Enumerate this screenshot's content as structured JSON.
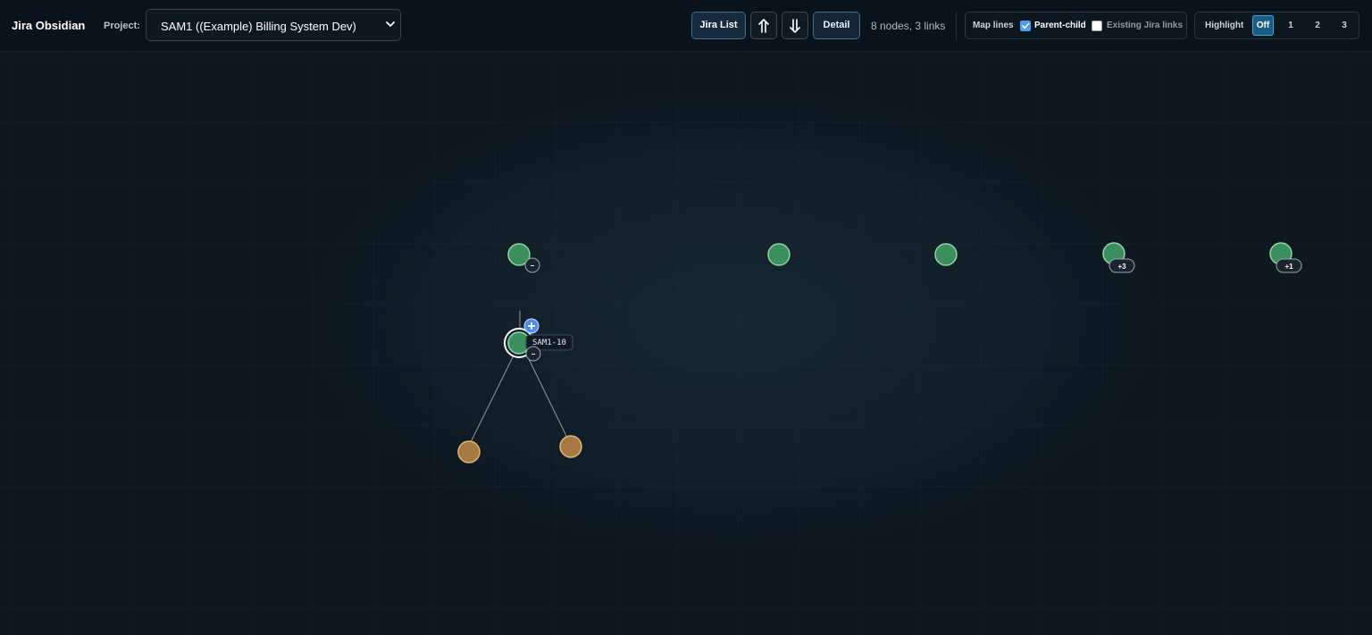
{
  "app": {
    "title": "Jira Obsidian"
  },
  "project": {
    "label": "Project:",
    "selected": "SAM1 ((Example) Billing System Dev)"
  },
  "toolbar": {
    "jira_list": "Jira List",
    "expand_up_icon": "double-arrow-up-icon",
    "expand_down_icon": "double-arrow-down-icon",
    "detail": "Detail",
    "status": "8 nodes, 3 links"
  },
  "map_lines": {
    "label": "Map lines",
    "parent_child": {
      "label": "Parent-child",
      "checked": true
    },
    "existing_jira_links": {
      "label": "Existing Jira links",
      "checked": false
    }
  },
  "highlight": {
    "label": "Highlight",
    "options": [
      "Off",
      "1",
      "2",
      "3"
    ],
    "selected": "Off"
  },
  "graph": {
    "colors": {
      "story": "#3a8f5c",
      "subtask": "#a77a43",
      "selected_ring": "#ffffff",
      "edge": "#8a96a0"
    },
    "selected_node": {
      "label": "SAM1-10",
      "add_icon": "plus-icon",
      "collapse_icon": "minus-icon"
    },
    "badges": [
      "+3",
      "+1"
    ],
    "collapse_badge": "−"
  }
}
